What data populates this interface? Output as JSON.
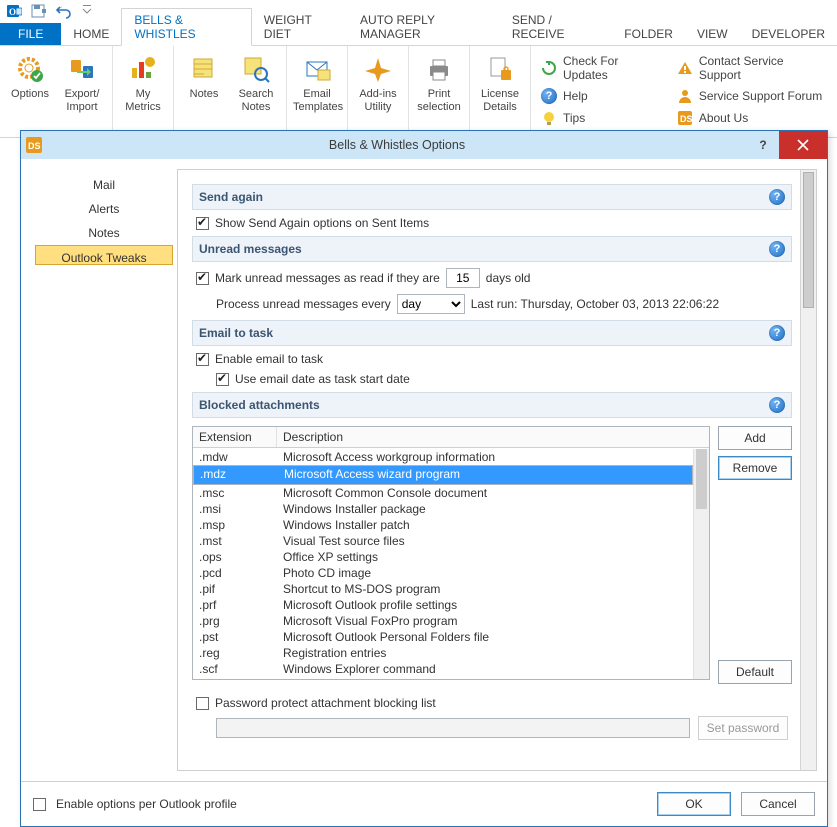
{
  "qat": {
    "tooltip": "Undo"
  },
  "tabs": {
    "file": "FILE",
    "home": "HOME",
    "bw": "BELLS & WHISTLES",
    "diet": "WEIGHT DIET",
    "arm": "AUTO REPLY MANAGER",
    "sr": "SEND / RECEIVE",
    "folder": "FOLDER",
    "view": "VIEW",
    "dev": "DEVELOPER"
  },
  "ribbon": {
    "options": "Options",
    "export": "Export/\nImport",
    "metrics": "My\nMetrics",
    "notes": "Notes",
    "searchnotes": "Search\nNotes",
    "templates": "Email\nTemplates",
    "addins": "Add-ins\nUtility",
    "print": "Print\nselection",
    "license": "License\nDetails",
    "links": {
      "updates": "Check For Updates",
      "help": "Help",
      "tips": "Tips",
      "contact": "Contact Service Support",
      "forum": "Service Support Forum",
      "about": "About Us"
    }
  },
  "dialog": {
    "title": "Bells & Whistles Options",
    "nav": {
      "mail": "Mail",
      "alerts": "Alerts",
      "notes": "Notes",
      "tweaks": "Outlook Tweaks"
    },
    "sendagain": {
      "title": "Send again",
      "opt": "Show Send Again options on Sent Items"
    },
    "unread": {
      "title": "Unread messages",
      "mark": "Mark unread messages as read if they are",
      "daysold": "days old",
      "days": "15",
      "process": "Process unread messages every",
      "freq": "day",
      "lastrun": "Last run: Thursday, October 03, 2013 22:06:22"
    },
    "e2t": {
      "title": "Email to task",
      "enable": "Enable email to task",
      "usedate": "Use email date as task start date"
    },
    "blocked": {
      "title": "Blocked attachments",
      "col1": "Extension",
      "col2": "Description",
      "rows": [
        {
          "ext": ".mdw",
          "desc": "Microsoft Access workgroup information"
        },
        {
          "ext": ".mdz",
          "desc": "Microsoft Access wizard program",
          "sel": true
        },
        {
          "ext": ".msc",
          "desc": "Microsoft Common Console document"
        },
        {
          "ext": ".msi",
          "desc": "Windows Installer package"
        },
        {
          "ext": ".msp",
          "desc": "Windows Installer patch"
        },
        {
          "ext": ".mst",
          "desc": "Visual Test source files"
        },
        {
          "ext": ".ops",
          "desc": "Office XP settings"
        },
        {
          "ext": ".pcd",
          "desc": "Photo CD image"
        },
        {
          "ext": ".pif",
          "desc": "Shortcut to MS-DOS program"
        },
        {
          "ext": ".prf",
          "desc": "Microsoft Outlook profile settings"
        },
        {
          "ext": ".prg",
          "desc": "Microsoft Visual FoxPro program"
        },
        {
          "ext": ".pst",
          "desc": "Microsoft Outlook Personal Folders file"
        },
        {
          "ext": ".reg",
          "desc": "Registration entries"
        },
        {
          "ext": ".scf",
          "desc": "Windows Explorer command"
        }
      ],
      "add": "Add",
      "remove": "Remove",
      "default": "Default",
      "pwchk": "Password protect attachment blocking list",
      "setpw": "Set password"
    },
    "footer": {
      "enable_profile": "Enable options per Outlook profile",
      "ok": "OK",
      "cancel": "Cancel"
    }
  }
}
